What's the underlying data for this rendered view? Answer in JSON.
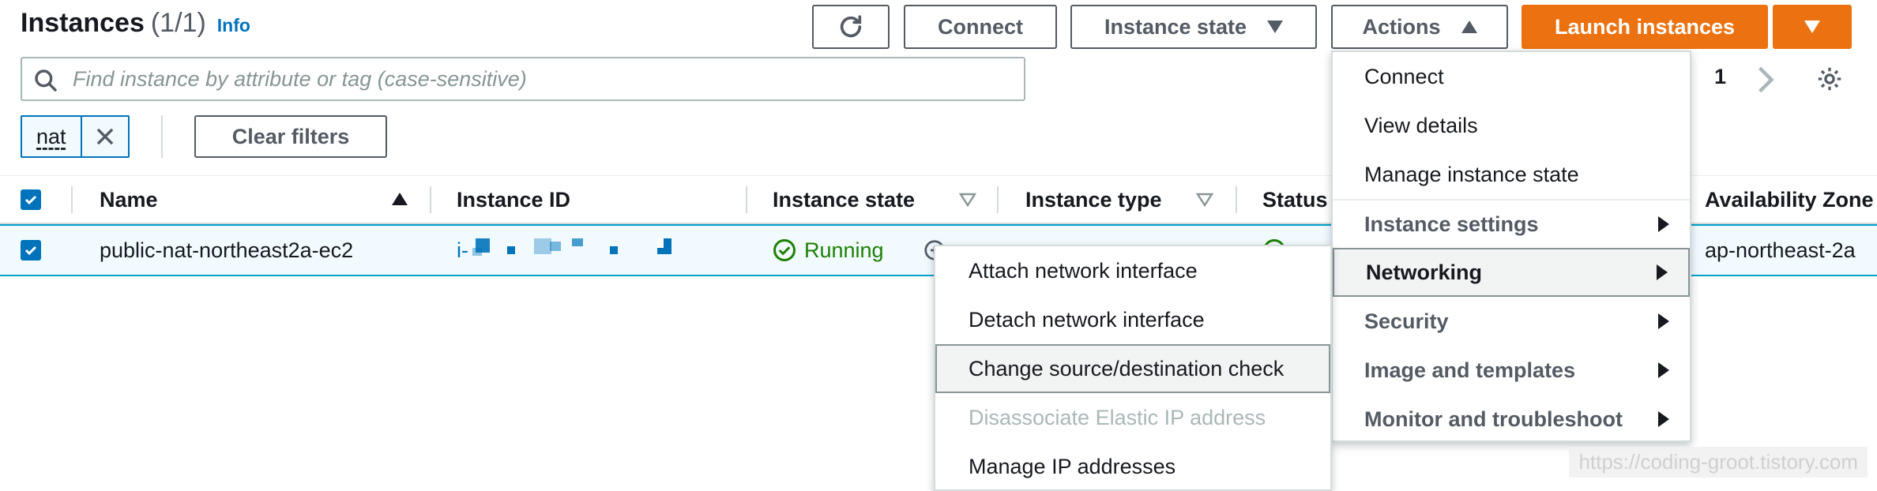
{
  "header": {
    "title": "Instances",
    "count": "(1/1)",
    "info_label": "Info"
  },
  "toolbar": {
    "refresh_icon": "refresh-icon",
    "connect_label": "Connect",
    "instance_state_label": "Instance state",
    "actions_label": "Actions",
    "launch_label": "Launch instances"
  },
  "search": {
    "placeholder": "Find instance by attribute or tag (case-sensitive)",
    "value": ""
  },
  "filters": {
    "token": "nat",
    "clear_label": "Clear filters"
  },
  "pagination": {
    "page": "1"
  },
  "table": {
    "columns": {
      "name": "Name",
      "instance_id": "Instance ID",
      "instance_state": "Instance state",
      "instance_type": "Instance type",
      "status": "Status",
      "availability_zone": "Availability Zone"
    },
    "rows": [
      {
        "name": "public-nat-northeast2a-ec2",
        "instance_id_prefix": "i-",
        "state": "Running",
        "availability_zone": "ap-northeast-2a"
      }
    ]
  },
  "actions_menu": {
    "items": [
      {
        "label": "Connect"
      },
      {
        "label": "View details"
      },
      {
        "label": "Manage instance state"
      },
      {
        "label": "Instance settings"
      },
      {
        "label": "Networking"
      },
      {
        "label": "Security"
      },
      {
        "label": "Image and templates"
      },
      {
        "label": "Monitor and troubleshoot"
      }
    ]
  },
  "networking_submenu": {
    "items": [
      {
        "label": "Attach network interface"
      },
      {
        "label": "Detach network interface"
      },
      {
        "label": "Change source/destination check"
      },
      {
        "label": "Disassociate Elastic IP address"
      },
      {
        "label": "Manage IP addresses"
      }
    ]
  },
  "watermark": "https://coding-groot.tistory.com",
  "colors": {
    "accent": "#0073bb",
    "primary_button": "#ec7211",
    "running": "#1d8102"
  }
}
